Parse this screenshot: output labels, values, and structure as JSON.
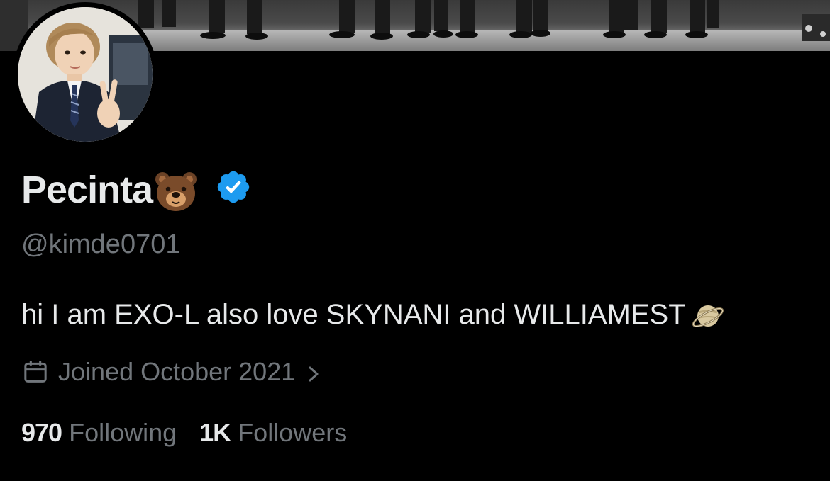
{
  "profile": {
    "display_name": "Pecinta",
    "name_emoji": "bear-face-emoji",
    "verified_icon": "verified-badge-icon",
    "handle": "@kimde0701",
    "bio_text": "hi I am EXO-L also love SKYNANI and WILLIAMEST",
    "bio_emoji": "ringed-planet-emoji",
    "joined_text": "Joined October 2021",
    "joined_icon": "calendar-icon",
    "stats": {
      "following_count": "970",
      "following_label": "Following",
      "followers_count": "1K",
      "followers_label": "Followers"
    }
  },
  "colors": {
    "background": "#000000",
    "primary_text": "#e7e9ea",
    "secondary_text": "#71767b",
    "verified_blue": "#1d9bf0"
  }
}
